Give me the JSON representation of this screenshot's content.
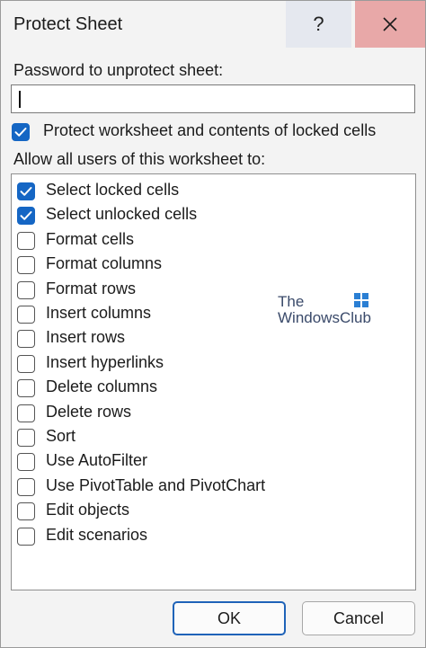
{
  "dialog": {
    "title": "Protect Sheet",
    "help_label": "?",
    "close_icon": "close-icon"
  },
  "password": {
    "label": "Password to unprotect sheet:",
    "value": ""
  },
  "protect": {
    "label": "Protect worksheet and contents of locked cells",
    "checked": true
  },
  "allow_label": "Allow all users of this worksheet to:",
  "permissions": [
    {
      "label": "Select locked cells",
      "checked": true
    },
    {
      "label": "Select unlocked cells",
      "checked": true
    },
    {
      "label": "Format cells",
      "checked": false
    },
    {
      "label": "Format columns",
      "checked": false
    },
    {
      "label": "Format rows",
      "checked": false
    },
    {
      "label": "Insert columns",
      "checked": false
    },
    {
      "label": "Insert rows",
      "checked": false
    },
    {
      "label": "Insert hyperlinks",
      "checked": false
    },
    {
      "label": "Delete columns",
      "checked": false
    },
    {
      "label": "Delete rows",
      "checked": false
    },
    {
      "label": "Sort",
      "checked": false
    },
    {
      "label": "Use AutoFilter",
      "checked": false
    },
    {
      "label": "Use PivotTable and PivotChart",
      "checked": false
    },
    {
      "label": "Edit objects",
      "checked": false
    },
    {
      "label": "Edit scenarios",
      "checked": false
    }
  ],
  "watermark": {
    "line1": "The",
    "line2": "WindowsClub"
  },
  "buttons": {
    "ok": "OK",
    "cancel": "Cancel"
  },
  "colors": {
    "accent": "#1566c4",
    "close_hover": "#e8a8a8"
  }
}
